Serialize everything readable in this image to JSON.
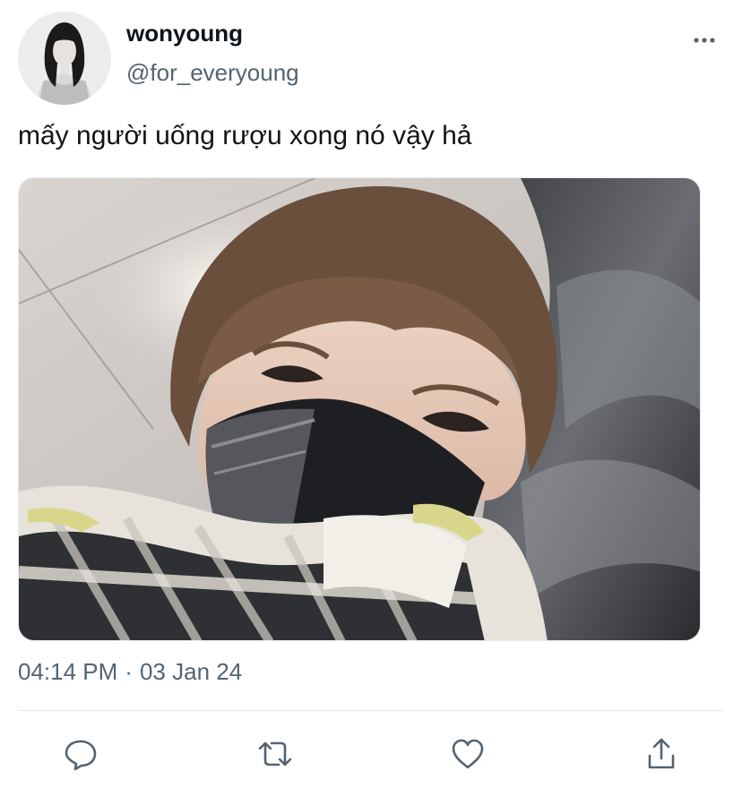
{
  "tweet": {
    "display_name": "wonyoung",
    "handle": "@for_everyoung",
    "text": "mấy người uống rượu xong nó vậy hả",
    "time": "04:14 PM",
    "separator": "·",
    "date": "03 Jan 24"
  },
  "icons": {
    "more": "more-horizontal-icon",
    "reply": "reply-icon",
    "retweet": "retweet-icon",
    "like": "like-heart-icon",
    "share": "share-upload-icon"
  },
  "colors": {
    "text_primary": "#0f1419",
    "text_secondary": "#536471",
    "icon": "#536471",
    "divider": "#e1e8ed"
  }
}
